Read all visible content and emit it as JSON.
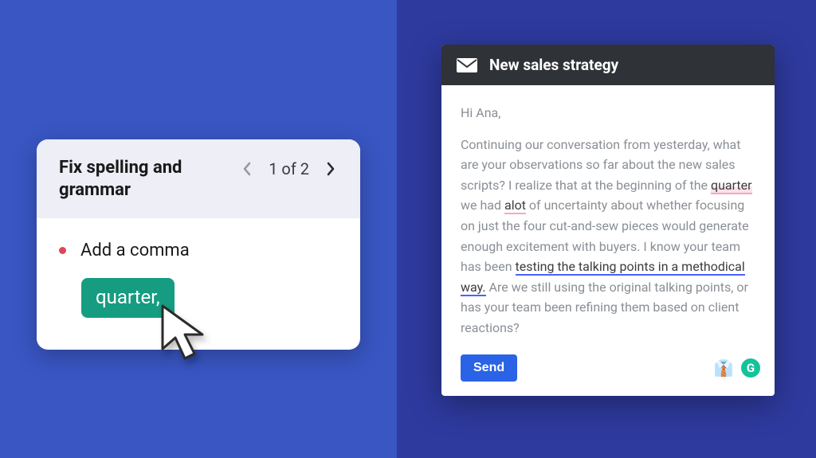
{
  "suggestion": {
    "title": "Fix spelling and grammar",
    "label": "Add a comma",
    "replacement": "quarter,",
    "pager": {
      "current": 1,
      "total": 2,
      "text": "1 of 2"
    }
  },
  "email": {
    "subject": "New sales strategy",
    "greeting": "Hi Ana,",
    "body": {
      "p1a": "Continuing our conversation from yesterday, what are your observations so far about the new sales scripts? I realize that at the beginning of the ",
      "hl1": "quarter",
      "p1b": " we had ",
      "hl2": "alot",
      "p1c": " of uncertainty about whether focusing on just the four cut-and-sew pieces would generate enough excitement with buyers. I know your team has been ",
      "hl3": "testing the talking points in a methodical way.",
      "p1d": " Are we still using the original talking points, or has your team been refining them based on client reactions?"
    },
    "send_label": "Send"
  },
  "icons": {
    "grammarly_letter": "G",
    "shirt_emoji": "👔"
  }
}
